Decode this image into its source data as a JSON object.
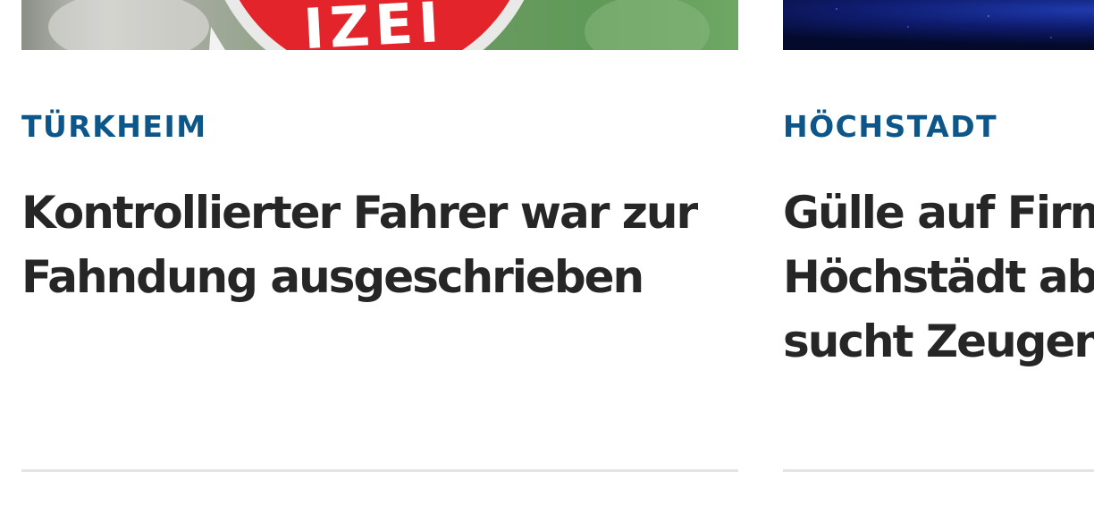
{
  "articles": [
    {
      "kicker": "TÜRKHEIM",
      "headline_line1": "Kontrollierter Fahrer war zur",
      "headline_line2": "Fahndung ausgeschrieben",
      "headline_line3": "",
      "image_text": "IZEI"
    },
    {
      "kicker": "HÖCHSTADT",
      "headline_line1": "Gülle auf Firm",
      "headline_line2": "Höchstädt ab",
      "headline_line3": "sucht Zeugen"
    }
  ],
  "colors": {
    "kicker": "#0d5689",
    "headline": "#262626",
    "divider": "#e4e4e4"
  }
}
